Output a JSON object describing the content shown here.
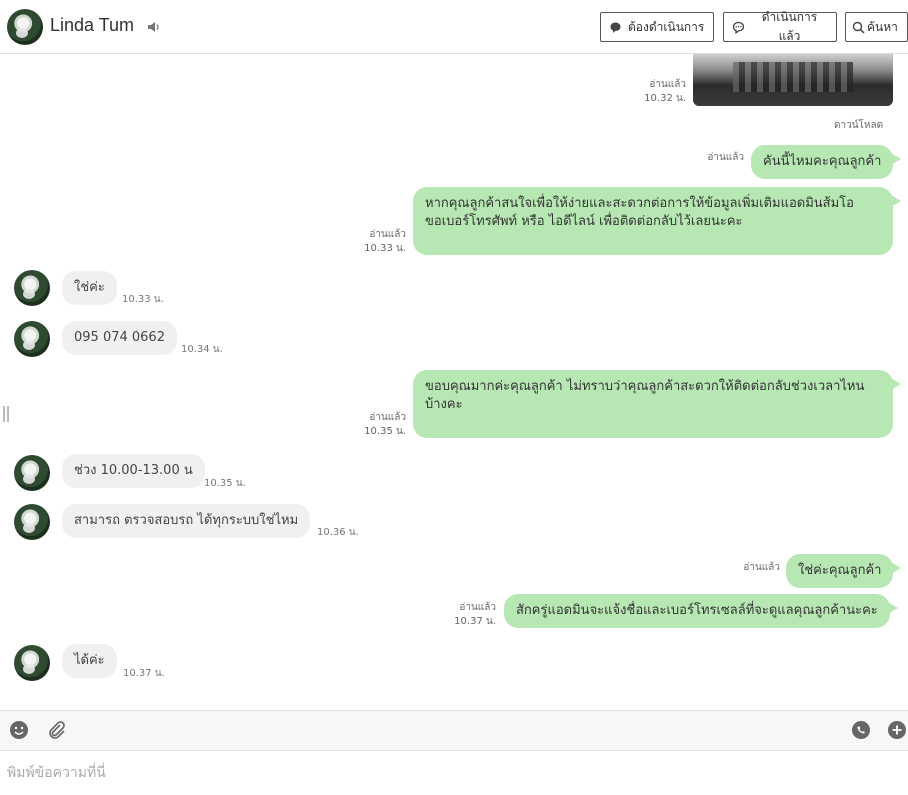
{
  "header": {
    "contact_name": "Linda Tum",
    "buttons": {
      "todo": "ต้องดำเนินการ",
      "done": "ดำเนินการแล้ว",
      "search": "ค้นหา"
    }
  },
  "chat": {
    "download_label": "ดาวน์โหลด",
    "read_label": "อ่านแล้ว",
    "msg1": {
      "text": "",
      "time": "10.32 น."
    },
    "msg2": {
      "text": "คันนี้ไหมคะคุณลูกค้า"
    },
    "msg3": {
      "line1": "หากคุณลูกค้าสนใจเพื่อให้ง่ายและสะดวกต่อการให้ข้อมูลเพิ่มเติมแอดมินส้มโอ",
      "line2": "ขอเบอร์โทรศัพท์ หรือ ไอดีไลน์ เพื่อติดต่อกลับไว้เลยนะคะ",
      "time": "10.33 น."
    },
    "in1": {
      "text": "ใช่ค่ะ",
      "time": "10.33 น."
    },
    "in2": {
      "text": "095 074 0662",
      "time": "10.34 น."
    },
    "msg4": {
      "line1": "ขอบคุณมากค่ะคุณลูกค้า ไม่ทราบว่าคุณลูกค้าสะดวกให้ติดต่อกลับช่วงเวลาไหน",
      "line2": "บ้างคะ",
      "time": "10.35 น."
    },
    "in3": {
      "text": "ช่วง 10.00-13.00 น",
      "time": "10.35 น."
    },
    "in4": {
      "text": "สามารถ ตรวจสอบรถ ได้ทุกระบบใช่ไหม",
      "time": "10.36 น."
    },
    "msg5": {
      "text": "ใช่ค่ะคุณลูกค้า"
    },
    "msg6": {
      "text": "สักครู่แอดมินจะแจ้งชื่อและเบอร์โทรเซลล์ที่จะดูแลคุณลูกค้านะคะ",
      "time": "10.37 น."
    },
    "in5": {
      "text": "ได้ค่ะ",
      "time": "10.37 น."
    }
  },
  "composer": {
    "placeholder": "พิมพ์ข้อความที่นี่"
  },
  "icons": [
    "speaker-icon",
    "chat-bubble-icon",
    "search-icon",
    "emoji-icon",
    "paperclip-icon",
    "whatsapp-icon",
    "add-icon"
  ],
  "colors": {
    "outgoing_bubble": "#b7e8b4",
    "incoming_bubble": "#f0f0f0"
  }
}
